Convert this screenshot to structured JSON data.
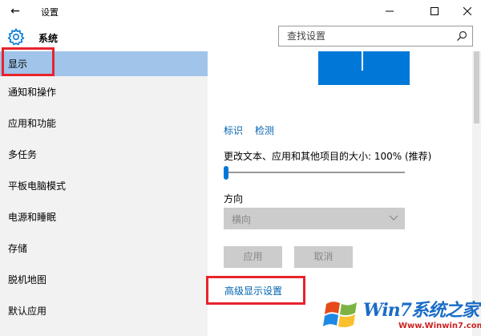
{
  "titlebar": {
    "back_icon": "back-arrow-icon",
    "title": "设置",
    "minimize_icon": "minimize-icon",
    "maximize_icon": "maximize-icon",
    "close_icon": "close-icon"
  },
  "header": {
    "icon": "gear-icon",
    "title": "系统",
    "search": {
      "placeholder": "查找设置",
      "value": "",
      "icon": "search-icon"
    }
  },
  "sidebar": {
    "items": [
      {
        "label": "显示",
        "selected": true
      },
      {
        "label": "通知和操作"
      },
      {
        "label": "应用和功能"
      },
      {
        "label": "多任务"
      },
      {
        "label": "平板电脑模式"
      },
      {
        "label": "电源和睡眠"
      },
      {
        "label": "存储"
      },
      {
        "label": "脱机地图"
      },
      {
        "label": "默认应用"
      }
    ]
  },
  "main": {
    "identify_link": "标识",
    "detect_link": "检测",
    "scale_label": "更改文本、应用和其他项目的大小: 100% (推荐)",
    "scale_level": 0.0,
    "orientation_label": "方向",
    "orientation_value": "横向",
    "apply_button": "应用",
    "cancel_button": "取消",
    "advanced_link": "高级显示设置"
  },
  "colors": {
    "accent": "#0078d7",
    "link": "#0063b1",
    "selected": "#a0c4ea",
    "highlight": "#e8242c"
  },
  "watermark": {
    "brand": "Win7系统之家",
    "site": "Www.Winwin7.com"
  }
}
